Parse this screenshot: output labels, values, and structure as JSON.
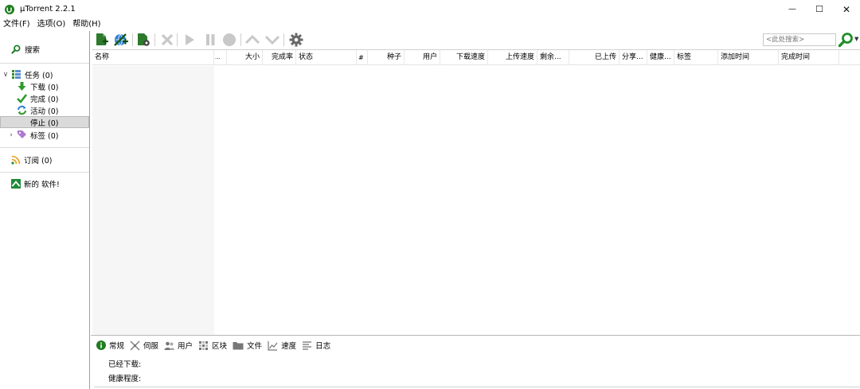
{
  "window": {
    "title": "µTorrent 2.2.1",
    "minimize": "—",
    "maximize": "☐",
    "close": "✕"
  },
  "menu": [
    "文件(F)",
    "选项(O)",
    "帮助(H)"
  ],
  "sidebar": {
    "search_label": "搜索",
    "tasks": {
      "label": "任务 (0)",
      "expanded": true
    },
    "items": [
      {
        "label": "下载 (0)",
        "icon": "download-arrow-icon"
      },
      {
        "label": "完成 (0)",
        "icon": "checkmark-icon"
      },
      {
        "label": "活动 (0)",
        "icon": "refresh-icon"
      },
      {
        "label": "停止 (0)",
        "icon": "stop-icon",
        "selected": true
      },
      {
        "label": "标签 (0)",
        "icon": "tag-icon"
      }
    ],
    "rss_label": "订阅 (0)",
    "new_label": "新的 软件!"
  },
  "toolbar": {
    "search_placeholder": "<此处搜索>",
    "buttons": [
      "add-torrent-icon",
      "add-url-icon",
      "create-torrent-icon",
      "remove-icon",
      "start-icon",
      "pause-icon",
      "stop-icon",
      "move-up-icon",
      "move-down-icon",
      "settings-icon"
    ]
  },
  "columns": [
    {
      "label": "名称"
    },
    {
      "label": "..."
    },
    {
      "label": "大小"
    },
    {
      "label": "完成率"
    },
    {
      "label": "状态"
    },
    {
      "label": "#"
    },
    {
      "label": "种子"
    },
    {
      "label": "用户"
    },
    {
      "label": "下载速度"
    },
    {
      "label": "上传速度"
    },
    {
      "label": "剩余..."
    },
    {
      "label": "已上传"
    },
    {
      "label": "分享..."
    },
    {
      "label": "健康..."
    },
    {
      "label": "标签"
    },
    {
      "label": "添加时间"
    },
    {
      "label": "完成时间"
    }
  ],
  "bottom": {
    "tabs": [
      {
        "label": "常规",
        "icon": "info-icon"
      },
      {
        "label": "伺服",
        "icon": "trackers-icon"
      },
      {
        "label": "用户",
        "icon": "peers-icon"
      },
      {
        "label": "区块",
        "icon": "pieces-icon"
      },
      {
        "label": "文件",
        "icon": "folder-icon"
      },
      {
        "label": "速度",
        "icon": "speed-chart-icon"
      },
      {
        "label": "日志",
        "icon": "log-icon"
      }
    ],
    "downloaded_label": "已经下载:",
    "health_label": "健康程度:"
  },
  "colors": {
    "accent_green": "#2e8b2e",
    "brand_green": "#1e7d1e",
    "disabled_gray": "#c8c8c8",
    "search_green": "#1f8f2a"
  }
}
